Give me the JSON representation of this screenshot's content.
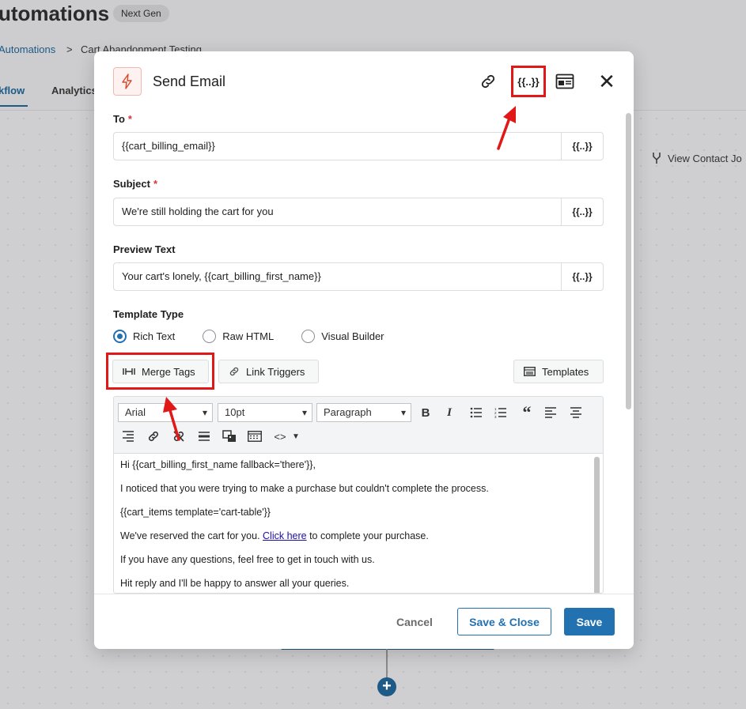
{
  "background": {
    "page_title": "utomations",
    "badge": "Next Gen",
    "breadcrumb": {
      "root": "Automations",
      "separator": ">",
      "current": "Cart Abandonment Testing"
    },
    "tabs": [
      "kflow",
      "Analytics"
    ],
    "view_contact": "View Contact Jo"
  },
  "modal": {
    "title": "Send Email",
    "header_icons": [
      "link-icon",
      "merge-tags-icon",
      "preview-icon",
      "close-icon"
    ],
    "merge_tag_glyph": "{{..}}",
    "close_glyph": "✕",
    "fields": {
      "to": {
        "label": "To",
        "required_mark": "*",
        "value": "{{cart_billing_email}}"
      },
      "subject": {
        "label": "Subject",
        "required_mark": "*",
        "value": "We're still holding the cart for you"
      },
      "preview": {
        "label": "Preview Text",
        "value": "Your cart's lonely, {{cart_billing_first_name}}"
      }
    },
    "template_type": {
      "label": "Template Type",
      "options": [
        "Rich Text",
        "Raw HTML",
        "Visual Builder"
      ],
      "selected": "Rich Text"
    },
    "buttons": {
      "merge_tags": "Merge Tags",
      "link_triggers": "Link Triggers",
      "templates": "Templates"
    },
    "toolbar": {
      "font": "Arial",
      "size": "10pt",
      "format": "Paragraph"
    },
    "content": {
      "line1": "Hi {{cart_billing_first_name fallback='there'}},",
      "line2": "I noticed that you were trying to make a purchase but couldn't complete the process.",
      "line3": "{{cart_items template='cart-table'}}",
      "line4_before": "We've reserved the cart for you. ",
      "line4_link": "Click here",
      "line4_after": " to complete your purchase.",
      "line5": "If you have any questions, feel free to get in touch with us.",
      "line6": "Hit reply and I'll be happy to answer all your queries."
    },
    "footer": {
      "cancel": "Cancel",
      "save_close": "Save & Close",
      "save": "Save"
    }
  },
  "colors": {
    "accent": "#2271b1",
    "highlight": "#e01818",
    "required": "#d63638"
  }
}
